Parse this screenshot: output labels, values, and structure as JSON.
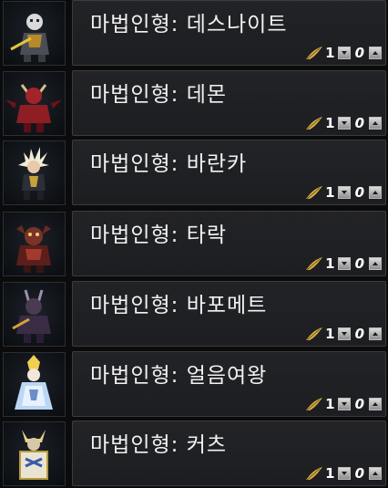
{
  "dolls": [
    {
      "name": "마법인형: 데스나이트",
      "count": "1",
      "value": "0",
      "icon": "death-knight-portrait",
      "color": "#c9c9c9"
    },
    {
      "name": "마법인형: 데몬",
      "count": "1",
      "value": "0",
      "icon": "demon-portrait",
      "color": "#b1272d"
    },
    {
      "name": "마법인형: 바란카",
      "count": "1",
      "value": "0",
      "icon": "baranka-portrait",
      "color": "#e8e2c8"
    },
    {
      "name": "마법인형: 타락",
      "count": "1",
      "value": "0",
      "icon": "tarak-portrait",
      "color": "#8a3a2e"
    },
    {
      "name": "마법인형: 바포메트",
      "count": "1",
      "value": "0",
      "icon": "baphomet-portrait",
      "color": "#6a4a7a"
    },
    {
      "name": "마법인형: 얼음여왕",
      "count": "1",
      "value": "0",
      "icon": "ice-queen-portrait",
      "color": "#cfe3ff"
    },
    {
      "name": "마법인형: 커츠",
      "count": "1",
      "value": "0",
      "icon": "kurtz-portrait",
      "color": "#e6d7a0"
    }
  ]
}
